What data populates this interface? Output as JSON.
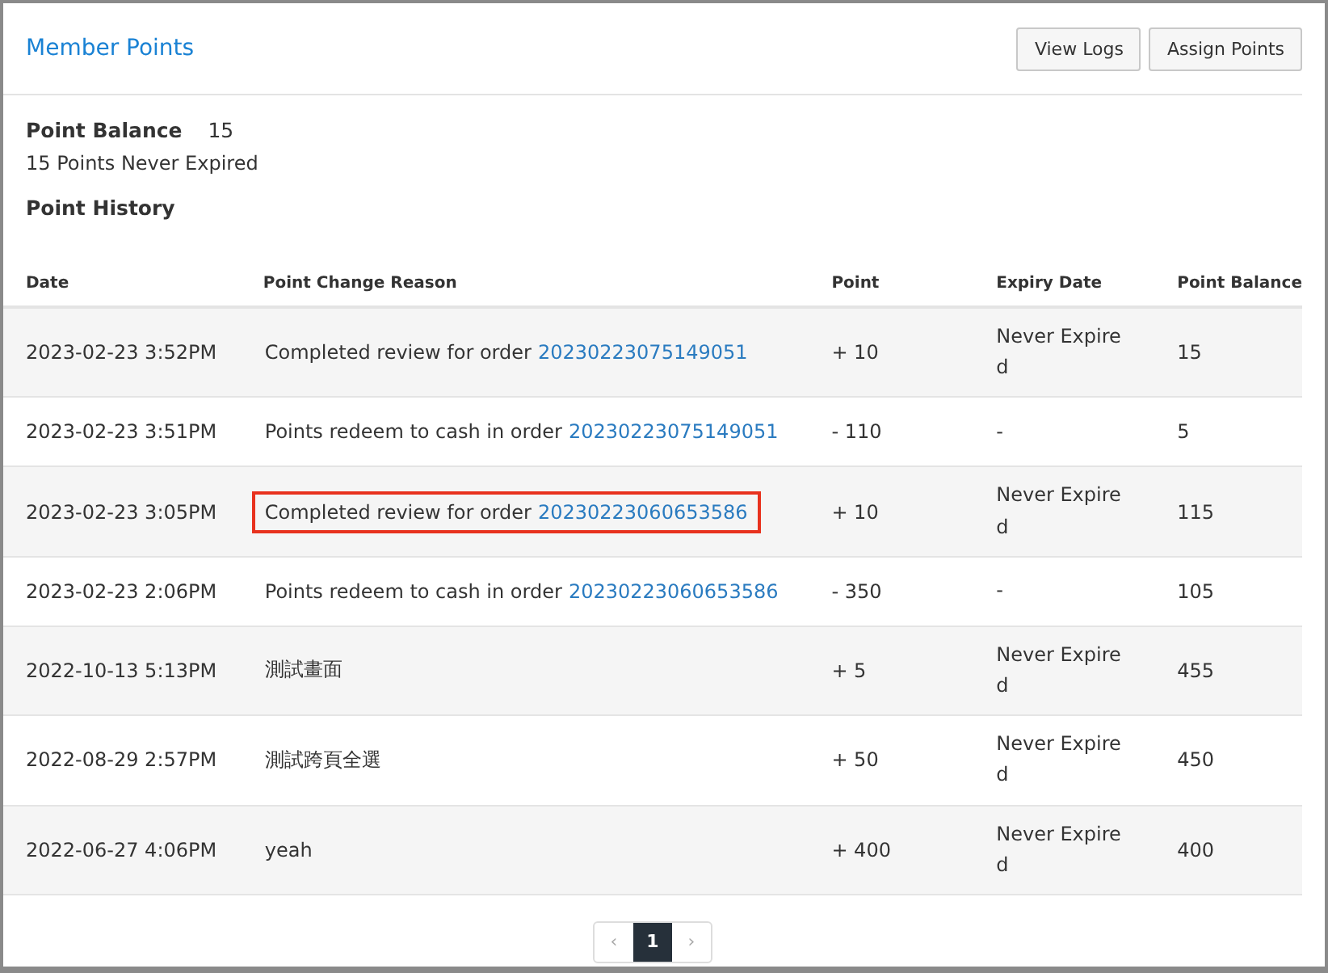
{
  "header": {
    "title": "Member Points",
    "buttons": [
      "View Logs",
      "Assign Points"
    ]
  },
  "summary": {
    "balance_label": "Point Balance",
    "balance_value": "15",
    "note": "15 Points Never Expired"
  },
  "history": {
    "title": "Point History",
    "columns": [
      "Date",
      "Point Change Reason",
      "Point",
      "Expiry Date",
      "Point Balance"
    ],
    "rows": [
      {
        "date": "2023-02-23 3:52PM",
        "reason": "Completed review for order",
        "order": "20230223075149051",
        "point": "+ 10",
        "expiry": "Never Expired",
        "balance": "15",
        "highlighted": false
      },
      {
        "date": "2023-02-23 3:51PM",
        "reason": "Points redeem to cash in order",
        "order": "20230223075149051",
        "point": "- 110",
        "expiry": "-",
        "balance": "5",
        "highlighted": false
      },
      {
        "date": "2023-02-23 3:05PM",
        "reason": "Completed review for order",
        "order": "20230223060653586",
        "point": "+ 10",
        "expiry": "Never Expired",
        "balance": "115",
        "highlighted": true
      },
      {
        "date": "2023-02-23 2:06PM",
        "reason": "Points redeem to cash in order",
        "order": "20230223060653586",
        "point": "- 350",
        "expiry": "-",
        "balance": "105",
        "highlighted": false
      },
      {
        "date": "2022-10-13 5:13PM",
        "reason": "測試畫面",
        "point": "+ 5",
        "expiry": "Never Expired",
        "balance": "455",
        "highlighted": false
      },
      {
        "date": "2022-08-29 2:57PM",
        "reason": "測試跨頁全選",
        "point": "+ 50",
        "expiry": "Never Expired",
        "balance": "450",
        "highlighted": false
      },
      {
        "date": "2022-06-27 4:06PM",
        "reason": "yeah",
        "point": "+ 400",
        "expiry": "Never Expired",
        "balance": "400",
        "highlighted": false
      }
    ]
  },
  "pagination": {
    "prev": "‹",
    "next": "›",
    "pages": [
      {
        "label": "1",
        "selected": true
      }
    ]
  }
}
